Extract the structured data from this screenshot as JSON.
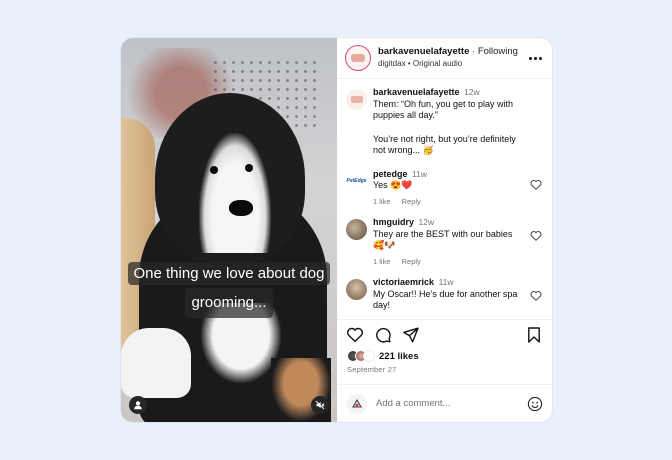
{
  "post": {
    "username": "barkavenuelafayette",
    "separator": "·",
    "follow_label": "Following",
    "audio_user": "digitdax",
    "audio_separator": "•",
    "audio_label": "Original audio",
    "caption_line1": "One thing we love about dog",
    "caption_line2": "grooming..."
  },
  "comments": [
    {
      "username": "barkavenuelafayette",
      "time": "12w",
      "text_p1": "Them: “Oh fun, you get to play with puppies all day.”",
      "text_p2": "You’re not right, but you’re definitely not wrong... 🥳"
    },
    {
      "username": "petedge",
      "avatar_text": "PetEdge",
      "time": "11w",
      "text": "Yes 😍❤️",
      "likes": "1 like",
      "reply": "Reply"
    },
    {
      "username": "hmguidry",
      "time": "12w",
      "text": "They are the BEST with our babies 🥰🐶",
      "likes": "1 like",
      "reply": "Reply"
    },
    {
      "username": "victoriaemrick",
      "time": "11w",
      "text": "My Oscar!! He’s due for another spa day!"
    }
  ],
  "engagement": {
    "likes_count": "221 likes",
    "date": "September 27"
  },
  "composer": {
    "placeholder": "Add a comment..."
  },
  "icons": {
    "like": "heart-icon",
    "comment": "comment-icon",
    "share": "paper-plane-icon",
    "save": "bookmark-icon",
    "emoji": "smiley-icon",
    "mute": "speaker-muted-icon",
    "tags": "user-icon",
    "more": "more-horizontal-icon"
  }
}
